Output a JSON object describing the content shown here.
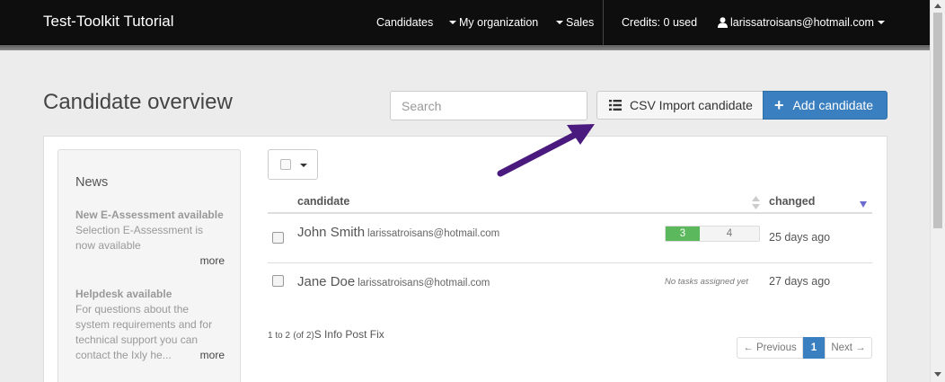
{
  "navbar": {
    "brand": "Test-Toolkit Tutorial",
    "candidates": "Candidates",
    "my_organization": "My organization",
    "sales": "Sales",
    "credits": "Credits: 0 used",
    "user": "larissatroisans@hotmail.com"
  },
  "header": {
    "title": "Candidate overview",
    "search_placeholder": "Search",
    "csv_import_label": "CSV Import candidate",
    "add_candidate_label": "Add candidate"
  },
  "news": {
    "title": "News",
    "items": [
      {
        "title": "New E-Assessment available",
        "body": "Selection E-Assessment is now available",
        "more": "more"
      },
      {
        "title": "Helpdesk available",
        "body": "For questions about the system requirements and for technical support you can contact the Ixly he...",
        "more": "more"
      }
    ]
  },
  "table": {
    "columns": {
      "candidate": "candidate",
      "changed": "changed"
    },
    "rows": [
      {
        "name": "John Smith",
        "email": "larissatroisans@hotmail.com",
        "tasks_done": "3",
        "tasks_total": "4",
        "changed": "25 days ago"
      },
      {
        "name": "Jane Doe",
        "email": "larissatroisans@hotmail.com",
        "no_tasks": "No tasks assigned yet",
        "changed": "27 days ago"
      }
    ]
  },
  "pagination": {
    "range": "1 to 2",
    "total": "(of 2)",
    "suffix": "S Info Post Fix",
    "previous": "← Previous",
    "current": "1",
    "next": "Next →"
  },
  "colors": {
    "navbar": "#0e0e0e",
    "primary": "#3a7fc0",
    "success": "#5cb85c",
    "annotation_arrow": "#4b1a7e"
  }
}
